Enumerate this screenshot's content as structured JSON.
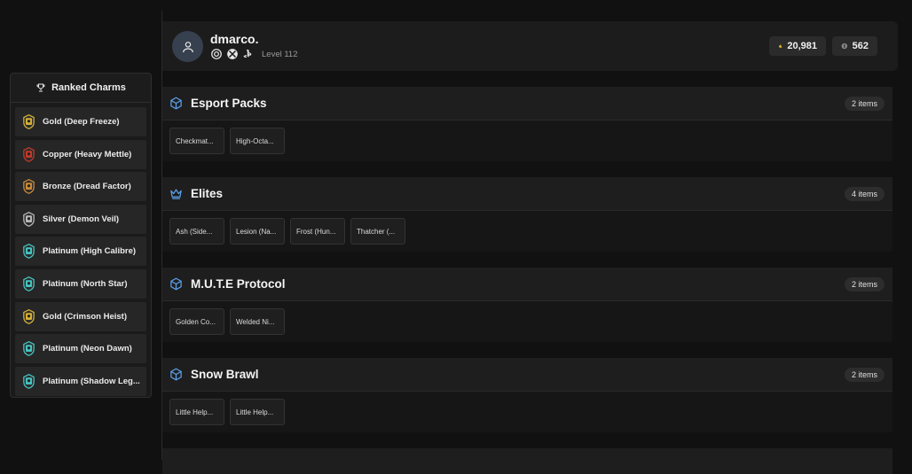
{
  "charms_panel": {
    "title": "Ranked Charms",
    "items": [
      {
        "label": "Gold (Deep Freeze)",
        "color": "#d4b03a"
      },
      {
        "label": "Copper (Heavy Mettle)",
        "color": "#c0392b"
      },
      {
        "label": "Bronze (Dread Factor)",
        "color": "#c98a3a"
      },
      {
        "label": "Silver (Demon Veil)",
        "color": "#b8b8b8"
      },
      {
        "label": "Platinum (High Calibre)",
        "color": "#46c4c0"
      },
      {
        "label": "Platinum (North Star)",
        "color": "#46c4c0"
      },
      {
        "label": "Gold (Crimson Heist)",
        "color": "#d4b03a"
      },
      {
        "label": "Platinum (Neon Dawn)",
        "color": "#46c4c0"
      },
      {
        "label": "Platinum (Shadow Leg...",
        "color": "#46c4c0"
      }
    ]
  },
  "profile": {
    "username": "dmarco.",
    "level": "Level 112",
    "platforms": [
      "ubisoft-icon",
      "xbox-icon",
      "playstation-icon"
    ],
    "credits": "20,981",
    "renown": "562"
  },
  "sections": [
    {
      "title": "Esport Packs",
      "icon": "box-icon",
      "count": "2 items",
      "cards": [
        "Checkmat...",
        "High-Octa..."
      ]
    },
    {
      "title": "Elites",
      "icon": "crown-icon",
      "count": "4 items",
      "cards": [
        "Ash (Side...",
        "Lesion (Na...",
        "Frost (Hun...",
        "Thatcher (..."
      ]
    },
    {
      "title": "M.U.T.E Protocol",
      "icon": "box-icon",
      "count": "2 items",
      "cards": [
        "Golden Co...",
        "Welded Ni..."
      ]
    },
    {
      "title": "Snow Brawl",
      "icon": "box-icon",
      "count": "2 items",
      "cards": [
        "Little Help...",
        "Little Help..."
      ]
    }
  ],
  "colors": {
    "accent": "#4a90e2",
    "background": "#111111"
  }
}
